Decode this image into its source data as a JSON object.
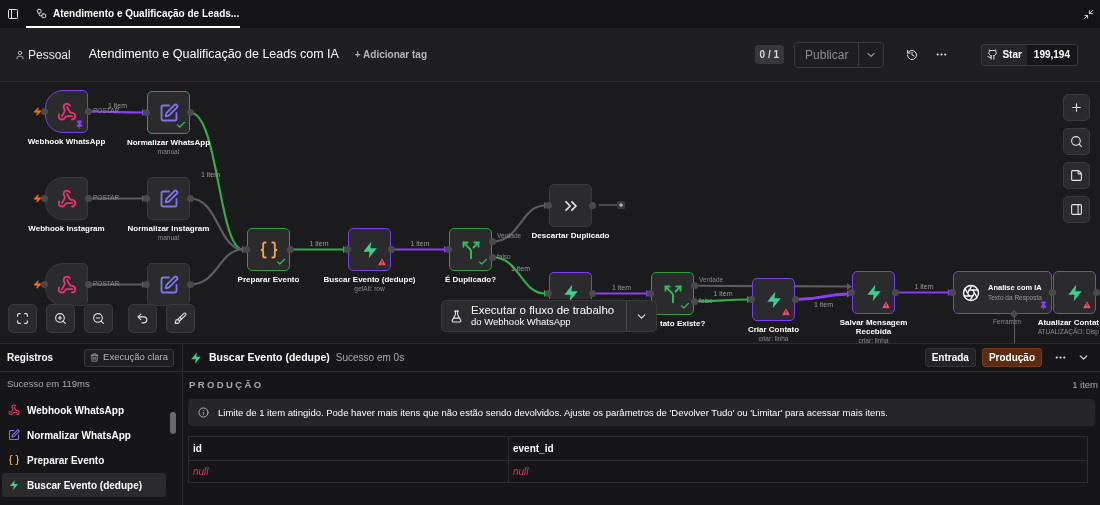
{
  "tab": {
    "title": "Atendimento e Qualificação de Leads..."
  },
  "header": {
    "project": "Pessoal",
    "title": "Atendimento e Qualificação de Leads com IA",
    "add_tag": "+ Adicionar tag",
    "counter": "0 / 1",
    "publish": "Publicar",
    "star": "Star",
    "stars_count": "199,194"
  },
  "canvas": {
    "nodes": [
      {
        "label": "Webhook WhatsApp",
        "kind": "webhook",
        "color": "#7b3ff2",
        "check": false,
        "warning": false,
        "pinned": true,
        "trigger": true,
        "outputs": [
          "POSTAR"
        ]
      },
      {
        "label": "Normalizar WhatsApp",
        "subtitle": "manual",
        "kind": "edit",
        "color": "#2f9e44",
        "check": true,
        "warning": false,
        "pinned": false,
        "trigger": false
      },
      {
        "label": "Webhook Instagram",
        "kind": "webhook",
        "color": "#3a393c",
        "check": false,
        "warning": false,
        "pinned": false,
        "trigger": true,
        "outputs": [
          "POSTAR"
        ]
      },
      {
        "label": "Normalizar Instagram",
        "subtitle": "manual",
        "kind": "edit",
        "color": "#3a393c",
        "check": false,
        "warning": false,
        "pinned": false,
        "trigger": false
      },
      {
        "kind": "webhook",
        "color": "#3a393c",
        "check": false,
        "warning": false,
        "pinned": false,
        "trigger": true,
        "outputs": [
          "POSTAR"
        ]
      },
      {
        "kind": "edit",
        "color": "#3a393c",
        "check": false,
        "warning": false,
        "pinned": false,
        "trigger": false
      },
      {
        "label": "Preparar Evento",
        "kind": "code",
        "color": "#2f9e44",
        "check": true,
        "warning": false,
        "pinned": false,
        "trigger": false
      },
      {
        "label": "Buscar Evento (dedupe)",
        "subtitle": "getAll: row",
        "kind": "supabase",
        "color": "#7b3ff2",
        "check": false,
        "warning": true,
        "pinned": false,
        "trigger": false
      },
      {
        "label": "É Duplicado?",
        "kind": "if",
        "color": "#2f9e44",
        "check": true,
        "warning": false,
        "pinned": false,
        "trigger": false,
        "outputs": [
          "Verdade",
          "falso"
        ]
      },
      {
        "label": "Descartar Duplicado",
        "kind": "forward",
        "color": "#3a393c",
        "check": false,
        "warning": false,
        "pinned": false,
        "trigger": false
      },
      {
        "kind": "supabase",
        "color": "#7b3ff2",
        "check": false,
        "warning": false,
        "pinned": false,
        "trigger": false
      },
      {
        "label": "tato Existe?",
        "kind": "if",
        "color": "#2f9e44",
        "check": true,
        "warning": false,
        "pinned": false,
        "trigger": false,
        "outputs": [
          "Verdade",
          "falso"
        ]
      },
      {
        "label": "Criar Contato",
        "subtitle": "criar: linha",
        "kind": "supabase",
        "color": "#7b3ff2",
        "check": false,
        "warning": true,
        "pinned": false,
        "trigger": false
      },
      {
        "label": "Salvar Mensagem Recebida",
        "subtitle": "criar: linha",
        "kind": "supabase",
        "color": "#7b3ff2",
        "check": false,
        "warning": true,
        "pinned": false,
        "trigger": false
      },
      {
        "label": "Analise com IA",
        "subtitle": "Texto da Resposta",
        "kind": "openai",
        "color": "#7b3ff2",
        "check": false,
        "warning": false,
        "pinned": true,
        "trigger": false,
        "tool_port": "Ferramen"
      },
      {
        "label": "Atualizar Contat",
        "subtitle": "ATUALIZAÇÃO: Disp",
        "kind": "supabase",
        "color": "#7b3ff2",
        "check": false,
        "warning": true,
        "pinned": false,
        "trigger": false
      }
    ],
    "edges": [
      {
        "color": "#8a3ff7",
        "label": "1 item"
      },
      {
        "color": "#2fae4a",
        "label": "1 item"
      },
      {
        "color": "#5c5b5e"
      },
      {
        "color": "#5c5b5e"
      },
      {
        "color": "#5c5b5e"
      },
      {
        "color": "#5c5b5e"
      },
      {
        "color": "#2fae4a",
        "label": "1 item"
      },
      {
        "color": "#8a3ff7",
        "label": "1 item"
      },
      {
        "color": "#5c5b5e"
      },
      {
        "color": "#2fae4a",
        "label": "1 item"
      },
      {
        "color": "#8a3ff7",
        "label": "1 item"
      },
      {
        "color": "#5c5b5e"
      },
      {
        "color": "#2fae4a",
        "label": "1 item"
      },
      {
        "color": "#8a3ff7",
        "label": "1 item"
      },
      {
        "color": "#8a3ff7",
        "label": "1 item"
      }
    ],
    "run_button": {
      "line1": "Executar o fluxo de trabalho",
      "line2": "do Webhook WhatsApp"
    }
  },
  "logs": {
    "title": "Registros",
    "clear": "Execução clara",
    "status": "Sucesso em 119ms",
    "items": [
      {
        "label": "Webhook WhatsApp",
        "kind": "webhook",
        "selected": false
      },
      {
        "label": "Normalizar WhatsApp",
        "kind": "edit",
        "selected": false
      },
      {
        "label": "Preparar Evento",
        "kind": "code",
        "selected": false
      },
      {
        "label": "Buscar Evento (dedupe)",
        "kind": "supabase",
        "selected": true
      }
    ]
  },
  "output": {
    "node": "Buscar Evento (dedupe)",
    "status": "Sucesso em 0s",
    "tabs": [
      {
        "label": "Entrada",
        "selected": false
      },
      {
        "label": "Produção",
        "selected": true
      }
    ],
    "heading": "PRODUÇÃO",
    "count": "1 item",
    "notice": "Limite de 1 item atingido. Pode haver mais itens que não estão sendo devolvidos. Ajuste os parâmetros de 'Devolver Tudo' ou 'Limitar' para acessar mais itens.",
    "columns": [
      "id",
      "event_id"
    ],
    "rows": [
      [
        "null",
        "null"
      ]
    ]
  }
}
